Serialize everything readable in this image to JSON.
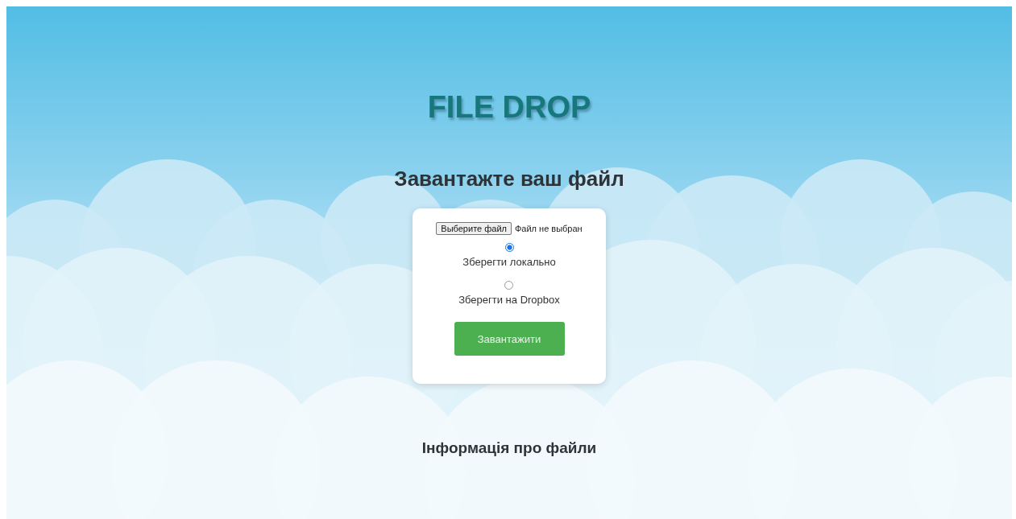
{
  "title": "FILE DROP",
  "upload_heading": "Завантажте ваш файл",
  "file_picker": {
    "button": "Выберите файл",
    "status": "Файл не выбран"
  },
  "storage_options": [
    {
      "label": "Зберегти локально",
      "selected": true
    },
    {
      "label": "Зберегти на Dropbox",
      "selected": false
    }
  ],
  "submit_button": "Завантажити",
  "info_heading": "Інформація про файли"
}
